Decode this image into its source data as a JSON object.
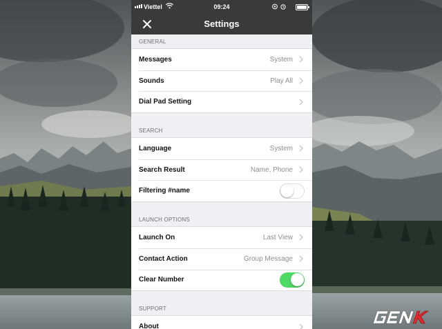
{
  "status_bar": {
    "carrier": "Viettel",
    "time": "09:24"
  },
  "nav": {
    "title": "Settings"
  },
  "sections": [
    {
      "header": "GENERAL",
      "rows": [
        {
          "label": "Messages",
          "value": "System"
        },
        {
          "label": "Sounds",
          "value": "Play All"
        },
        {
          "label": "Dial Pad Setting",
          "value": ""
        }
      ]
    },
    {
      "header": "SEARCH",
      "rows": [
        {
          "label": "Language",
          "value": "System"
        },
        {
          "label": "Search Result",
          "value": "Name, Phone"
        },
        {
          "label": "Filtering #name",
          "toggle": false
        }
      ]
    },
    {
      "header": "LAUNCH OPTIONS",
      "rows": [
        {
          "label": "Launch On",
          "value": "Last View"
        },
        {
          "label": "Contact Action",
          "value": "Group Message"
        },
        {
          "label": "Clear Number",
          "toggle": true
        }
      ]
    },
    {
      "header": "SUPPORT",
      "rows": [
        {
          "label": "About",
          "value": ""
        }
      ]
    }
  ],
  "watermark": "GENK",
  "colors": {
    "nav_bg": "#3a3a3a",
    "toggle_on": "#4cd964",
    "page_bg": "#efeff4",
    "secondary_text": "#8e8e93"
  }
}
